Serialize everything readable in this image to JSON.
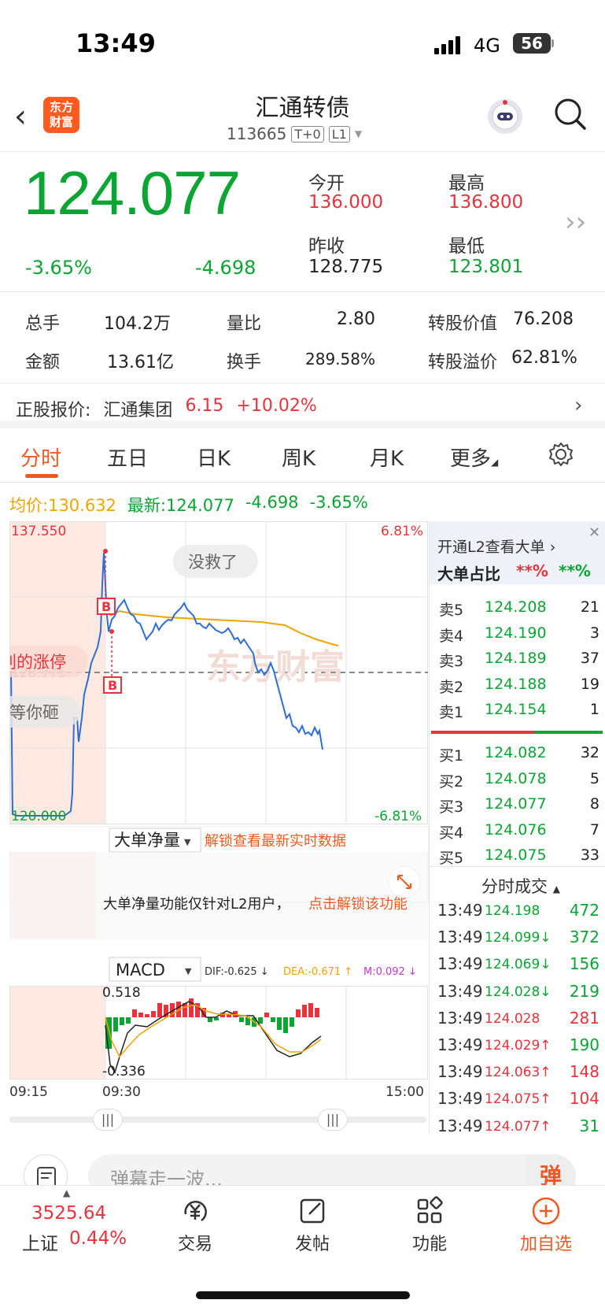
{
  "status_bar": {
    "time": "13:49",
    "network": "4G",
    "battery": "56"
  },
  "header": {
    "title": "汇通转债",
    "code": "113665",
    "tag1": "T+0",
    "tag2": "L1",
    "logo_line1": "东方",
    "logo_line2": "财富"
  },
  "quote": {
    "price": "124.077",
    "change_pct": "-3.65%",
    "change": "-4.698",
    "open_label": "今开",
    "open": "136.000",
    "high_label": "最高",
    "high": "136.800",
    "prev_close_label": "昨收",
    "prev_close": "128.775",
    "low_label": "最低",
    "low": "123.801"
  },
  "stats": {
    "volume_label": "总手",
    "volume": "104.2万",
    "ratio_label": "量比",
    "ratio": "2.80",
    "conv_value_label": "转股价值",
    "conv_value": "76.208",
    "amount_label": "金额",
    "amount": "13.61亿",
    "turnover_label": "换手",
    "turnover": "289.58%",
    "premium_label": "转股溢价",
    "premium": "62.81%"
  },
  "underlying": {
    "label": "正股报价:",
    "name": "汇通集团",
    "price": "6.15",
    "change": "+10.02%"
  },
  "tabs": [
    "分时",
    "五日",
    "日K",
    "周K",
    "月K",
    "更多"
  ],
  "summary": {
    "avg_label": "均价:",
    "avg": "130.632",
    "latest_label": "最新:",
    "latest": "124.077",
    "change": "-4.698",
    "change_pct": "-3.65%"
  },
  "chart": {
    "y_top": "137.550",
    "y_bottom": "120.000",
    "pct_top": "6.81%",
    "pct_bottom": "-6.81%",
    "prev_close_mark": "128.775",
    "danmu": [
      "没救了",
      "别的涨停",
      "等你砸"
    ],
    "watermark": "东方财富",
    "marker": "B",
    "time_start": "09:15",
    "time_open": "09:30",
    "time_end": "15:00"
  },
  "net_panel": {
    "selector": "大单净量",
    "unlock": "解锁查看最新实时数据",
    "notice": "大单净量功能仅针对L2用户，",
    "notice_link": "点击解锁该功能"
  },
  "macd": {
    "selector": "MACD",
    "dif": "DIF:-0.625 ↓",
    "dea": "DEA:-0.671 ↑",
    "m": "M:0.092 ↓",
    "top": "0.518",
    "bottom": "-0.336"
  },
  "order_book": {
    "l2_prompt": "开通L2查看大单",
    "big_ratio_label": "大单占比",
    "big_ratio_red": "**%",
    "big_ratio_green": "**%",
    "asks": [
      {
        "name": "卖5",
        "price": "124.208",
        "vol": "21"
      },
      {
        "name": "卖4",
        "price": "124.190",
        "vol": "3"
      },
      {
        "name": "卖3",
        "price": "124.189",
        "vol": "37"
      },
      {
        "name": "卖2",
        "price": "124.188",
        "vol": "19"
      },
      {
        "name": "卖1",
        "price": "124.154",
        "vol": "1"
      }
    ],
    "bids": [
      {
        "name": "买1",
        "price": "124.082",
        "vol": "32"
      },
      {
        "name": "买2",
        "price": "124.078",
        "vol": "5"
      },
      {
        "name": "买3",
        "price": "124.077",
        "vol": "8"
      },
      {
        "name": "买4",
        "price": "124.076",
        "vol": "7"
      },
      {
        "name": "买5",
        "price": "124.075",
        "vol": "33"
      }
    ],
    "ticks_label": "分时成交",
    "ticks": [
      {
        "time": "13:49",
        "price": "124.198",
        "vol": "472",
        "dir": "",
        "color": "#0aa533"
      },
      {
        "time": "13:49",
        "price": "124.099↓",
        "vol": "372",
        "dir": "down",
        "color": "#0aa533"
      },
      {
        "time": "13:49",
        "price": "124.069↓",
        "vol": "156",
        "dir": "down",
        "color": "#0aa533"
      },
      {
        "time": "13:49",
        "price": "124.028↓",
        "vol": "219",
        "dir": "down",
        "color": "#0aa533"
      },
      {
        "time": "13:49",
        "price": "124.028",
        "vol": "281",
        "dir": "",
        "color": "#e8323c"
      },
      {
        "time": "13:49",
        "price": "124.029↑",
        "vol": "190",
        "dir": "up",
        "color": "#0aa533"
      },
      {
        "time": "13:49",
        "price": "124.063↑",
        "vol": "148",
        "dir": "up",
        "color": "#e8323c"
      },
      {
        "time": "13:49",
        "price": "124.075↑",
        "vol": "104",
        "dir": "up",
        "color": "#e8323c"
      },
      {
        "time": "13:49",
        "price": "124.077↑",
        "vol": "31",
        "dir": "up",
        "color": "#0aa533"
      }
    ]
  },
  "bottom": {
    "danmu_placeholder": "弹幕走一波...",
    "danmu_btn": "弹",
    "index_value": "3525.64",
    "index_name": "上证",
    "index_change": "0.44%",
    "trade": "交易",
    "post": "发帖",
    "functions": "功能",
    "add_watch": "加自选"
  },
  "colors": {
    "up": "#e8323c",
    "down": "#0aa533",
    "accent": "#f05a22",
    "avg_line": "#f0a400",
    "price_line": "#2c6fd6"
  }
}
